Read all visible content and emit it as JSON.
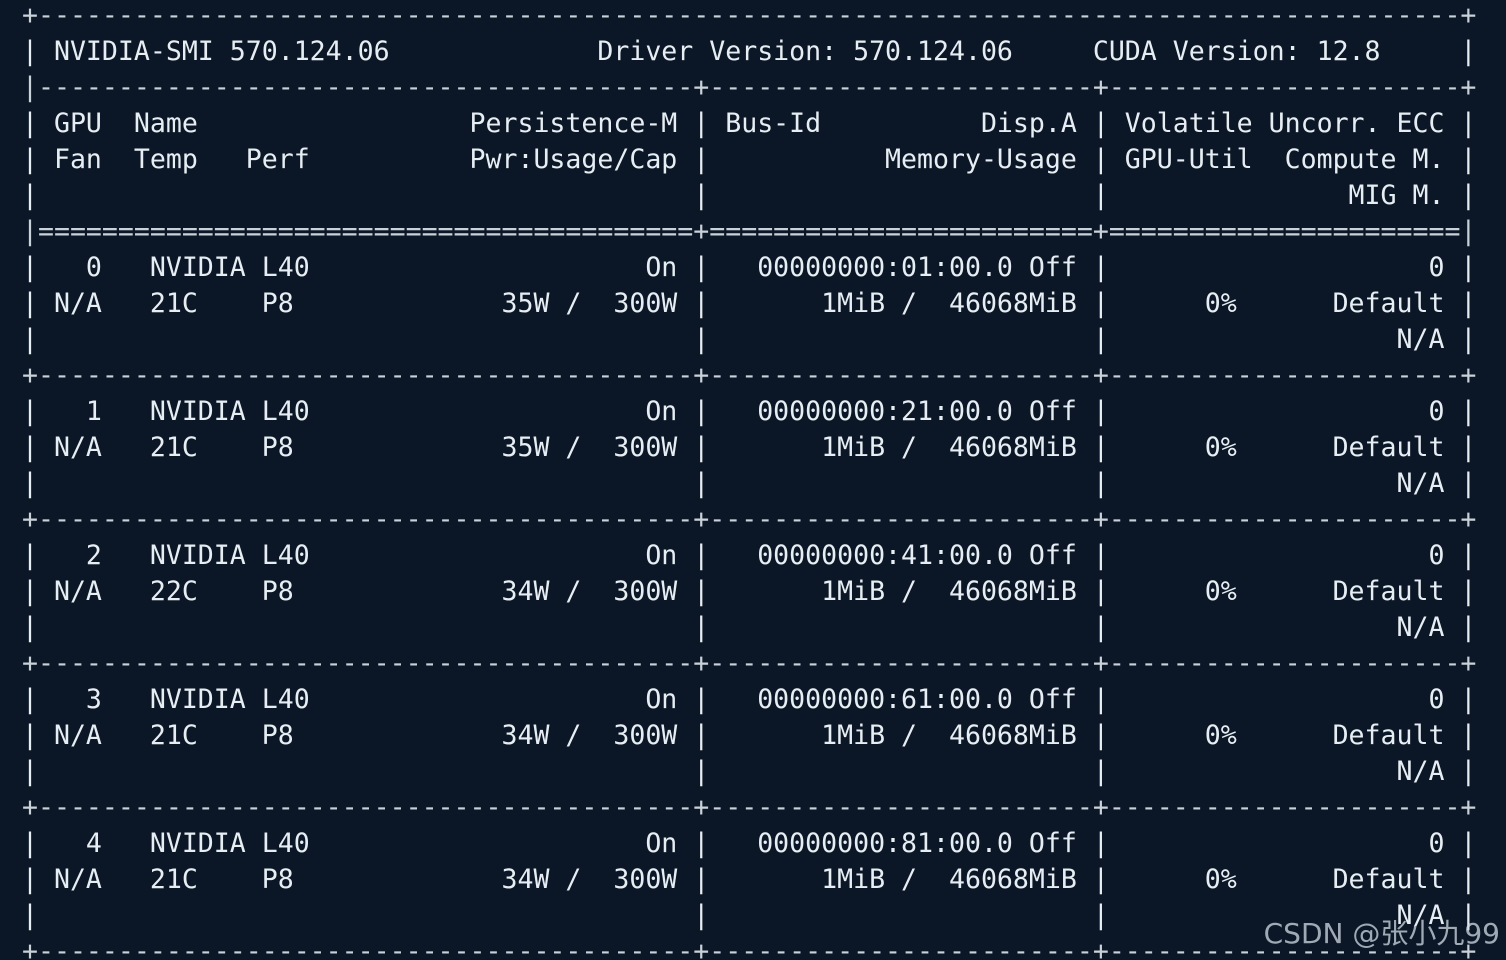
{
  "terminal": {
    "header": {
      "smi_version": "NVIDIA-SMI 570.124.06",
      "driver_version": "Driver Version: 570.124.06",
      "cuda_version": "CUDA Version: 12.8"
    },
    "columns": {
      "gpu": "GPU",
      "name": "Name",
      "persistence": "Persistence-M",
      "bus_id": "Bus-Id",
      "disp": "Disp.A",
      "volatile": "Volatile Uncorr. ECC",
      "fan": "Fan",
      "temp": "Temp",
      "perf": "Perf",
      "pwr": "Pwr:Usage/Cap",
      "memory": "Memory-Usage",
      "gpu_util": "GPU-Util",
      "compute": "Compute M.",
      "mig": "MIG M."
    },
    "gpus": [
      {
        "index": "0",
        "name": "NVIDIA L40",
        "persistence": "On",
        "bus_id": "00000000:01:00.0",
        "disp": "Off",
        "ecc": "0",
        "fan": "N/A",
        "temp": "21C",
        "perf": "P8",
        "pwr_usage": "35W",
        "pwr_cap": "300W",
        "mem_used": "1MiB",
        "mem_total": "46068MiB",
        "util": "0%",
        "compute": "Default",
        "mig": "N/A"
      },
      {
        "index": "1",
        "name": "NVIDIA L40",
        "persistence": "On",
        "bus_id": "00000000:21:00.0",
        "disp": "Off",
        "ecc": "0",
        "fan": "N/A",
        "temp": "21C",
        "perf": "P8",
        "pwr_usage": "35W",
        "pwr_cap": "300W",
        "mem_used": "1MiB",
        "mem_total": "46068MiB",
        "util": "0%",
        "compute": "Default",
        "mig": "N/A"
      },
      {
        "index": "2",
        "name": "NVIDIA L40",
        "persistence": "On",
        "bus_id": "00000000:41:00.0",
        "disp": "Off",
        "ecc": "0",
        "fan": "N/A",
        "temp": "22C",
        "perf": "P8",
        "pwr_usage": "34W",
        "pwr_cap": "300W",
        "mem_used": "1MiB",
        "mem_total": "46068MiB",
        "util": "0%",
        "compute": "Default",
        "mig": "N/A"
      },
      {
        "index": "3",
        "name": "NVIDIA L40",
        "persistence": "On",
        "bus_id": "00000000:61:00.0",
        "disp": "Off",
        "ecc": "0",
        "fan": "N/A",
        "temp": "21C",
        "perf": "P8",
        "pwr_usage": "34W",
        "pwr_cap": "300W",
        "mem_used": "1MiB",
        "mem_total": "46068MiB",
        "util": "0%",
        "compute": "Default",
        "mig": "N/A"
      },
      {
        "index": "4",
        "name": "NVIDIA L40",
        "persistence": "On",
        "bus_id": "00000000:81:00.0",
        "disp": "Off",
        "ecc": "0",
        "fan": "N/A",
        "temp": "21C",
        "perf": "P8",
        "pwr_usage": "34W",
        "pwr_cap": "300W",
        "mem_used": "1MiB",
        "mem_total": "46068MiB",
        "util": "0%",
        "compute": "Default",
        "mig": "N/A"
      }
    ]
  },
  "watermark": "CSDN @张小九99",
  "colors": {
    "background": "#0b1726",
    "text": "#e6edf3"
  }
}
